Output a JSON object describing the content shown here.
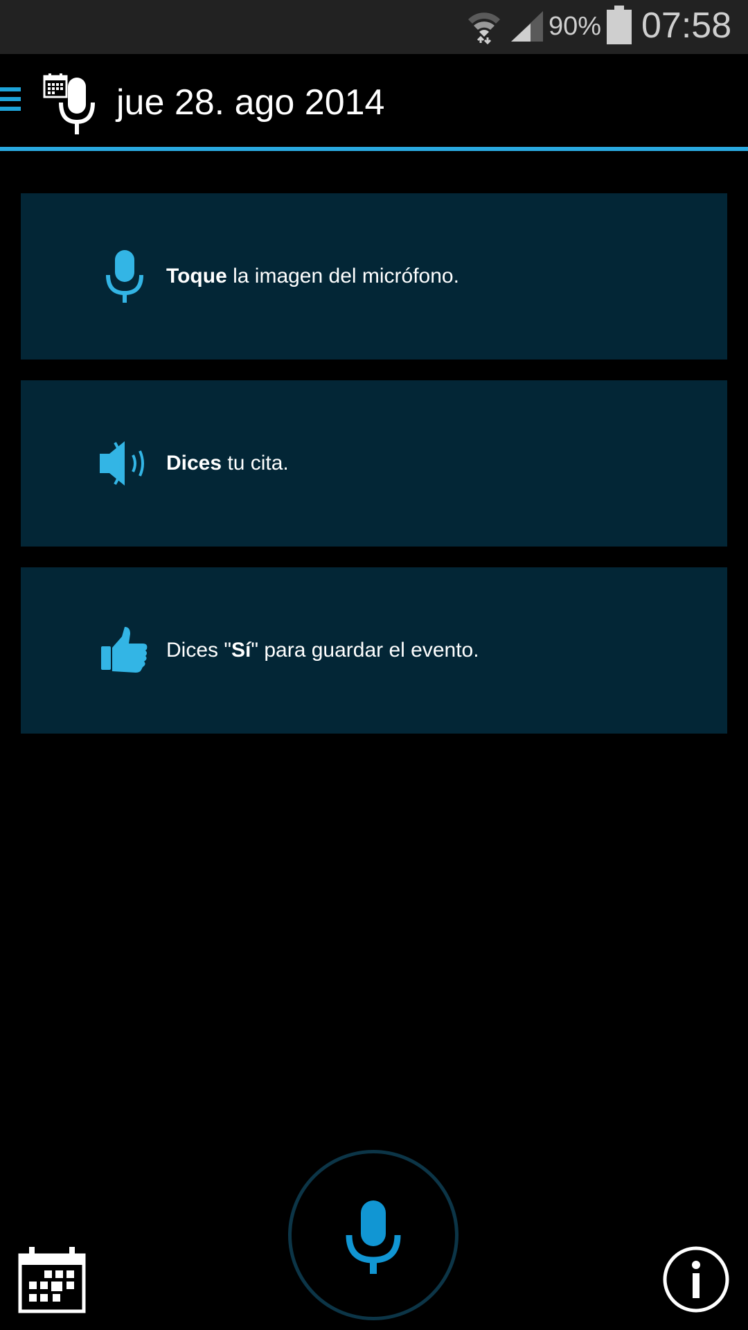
{
  "status_bar": {
    "battery_percent": "90%",
    "time": "07:58"
  },
  "action_bar": {
    "title": "jue 28. ago 2014",
    "icons": [
      "drawer-menu-icon",
      "calendar-microphone-app-icon"
    ]
  },
  "colors": {
    "accent": "#2aa9df",
    "card_background": "#032636",
    "mic_blue": "#1196d3",
    "status_bar": "#222222"
  },
  "cards": [
    {
      "icon": "microphone-icon",
      "bold": "Toque",
      "rest": " la imagen del micrófono."
    },
    {
      "icon": "speaker-icon",
      "bold": "Dices",
      "rest": " tu cita."
    },
    {
      "icon": "thumbs-up-icon",
      "prefix": "Dices \"",
      "bold": "Sí",
      "rest": "\" para guardar el evento."
    }
  ],
  "bottom_bar": {
    "icons": [
      "calendar-icon",
      "microphone-icon",
      "info-icon"
    ]
  }
}
